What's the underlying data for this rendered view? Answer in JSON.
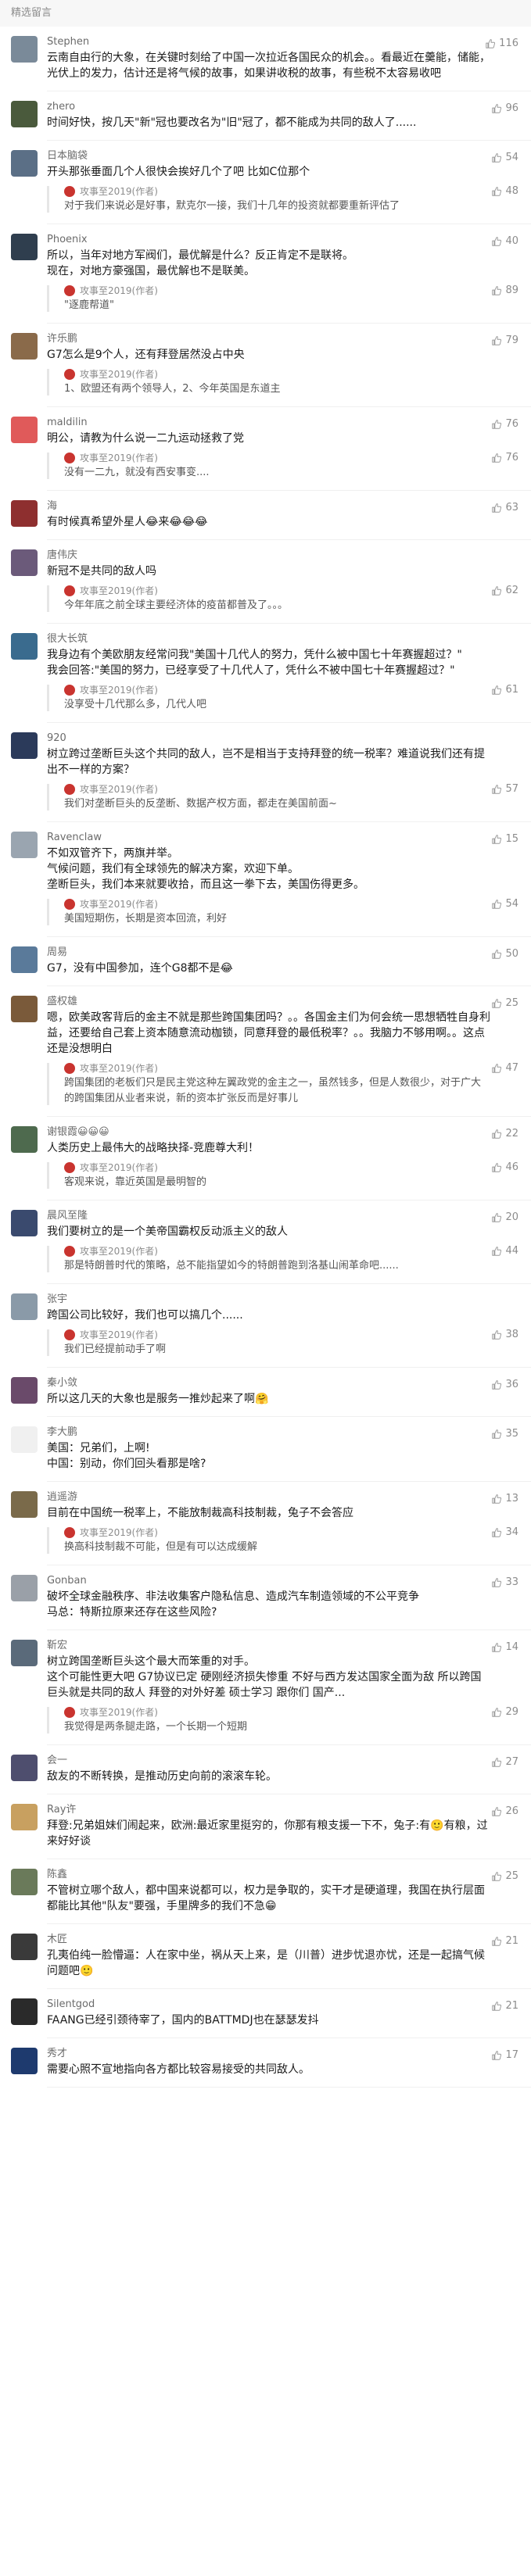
{
  "section_title": "精选留言",
  "author_name": "攻事至2019(作者)",
  "comments": [
    {
      "nick": "Stephen",
      "likes": "116",
      "avatar_color": "#7a8a99",
      "content": "云南自由行的大象，在关键时刻给了中国一次拉近各国民众的机会。。看最近在羹能，储能，光伏上的发力，估计还是将气候的故事，如果讲收税的故事，有些税不太容易收吧",
      "reply": null
    },
    {
      "nick": "zhero",
      "likes": "96",
      "avatar_color": "#4a5a3c",
      "content": "时间好快，按几天\"新\"冠也要改名为\"旧\"冠了，都不能成为共同的敌人了......",
      "reply": null
    },
    {
      "nick": "日本脑袋",
      "likes": "54",
      "avatar_color": "#5b6f86",
      "content": "开头那张垂面几个人很快会挨好几个了吧 比如C位那个",
      "reply": {
        "likes": "48",
        "content": "对于我们来说必是好事，默克尔一接，我们十几年的投资就都要重新评估了"
      }
    },
    {
      "nick": "Phoenix",
      "likes": "40",
      "avatar_color": "#2f3e4e",
      "content": "所以，当年对地方军阀们，最优解是什么？反正肯定不是联将。\n现在，对地方豪强国，最优解也不是联美。",
      "reply": {
        "likes": "89",
        "content": "\"逐鹿帮道\""
      }
    },
    {
      "nick": "许乐鹏",
      "likes": "79",
      "avatar_color": "#8a6a4a",
      "content": "G7怎么是9个人，还有拜登居然没占中央",
      "reply": {
        "likes": "",
        "content": "1、欧盟还有两个领导人，2、今年英国是东道主"
      }
    },
    {
      "nick": "maldilin",
      "likes": "76",
      "avatar_color": "#e05a5a",
      "content": "明公，请教为什么说一二九运动拯救了党",
      "reply": {
        "likes": "76",
        "content": "没有一二九，就没有西安事变...."
      }
    },
    {
      "nick": "海",
      "likes": "63",
      "avatar_color": "#8e2f2f",
      "content": "有时候真希望外星人😂来😂😂😂",
      "reply": null
    },
    {
      "nick": "唐伟庆",
      "likes": "",
      "avatar_color": "#6b5a7a",
      "content": "新冠不是共同的敌人吗",
      "reply": {
        "likes": "62",
        "content": "今年年底之前全球主要经济体的疫苗都普及了。。。"
      }
    },
    {
      "nick": "很大长筑",
      "likes": "",
      "avatar_color": "#3a6b8e",
      "content": "我身边有个美欧朋友经常问我\"美国十几代人的努力，凭什么被中国七十年赛握超过？\"\n我会回答:\"美国的努力，已经享受了十几代人了，凭什么不被中国七十年赛握超过？\"",
      "reply": {
        "likes": "61",
        "content": "没享受十几代那么多，几代人吧"
      }
    },
    {
      "nick": "920",
      "likes": "",
      "avatar_color": "#2b3a5a",
      "content": "树立跨过垄断巨头这个共同的敌人，岂不是相当于支持拜登的统一税率？难道说我们还有提出不一样的方案？",
      "reply": {
        "likes": "57",
        "content": "我们对垄断巨头的反垄断、数据产权方面，都走在美国前面~"
      }
    },
    {
      "nick": "Ravenclaw",
      "likes": "15",
      "avatar_color": "#9aa5b0",
      "content": "不如双管齐下，两旗并举。\n气候问题，我们有全球领先的解决方案，欢迎下单。\n垄断巨头，我们本来就要收拾，而且这一拳下去，美国伤得更多。",
      "reply": {
        "likes": "54",
        "content": "美国短期伤，长期是资本回流，利好"
      }
    },
    {
      "nick": "周易",
      "likes": "50",
      "avatar_color": "#5a7a9a",
      "content": "G7，没有中国参加，连个G8都不是😂",
      "reply": null
    },
    {
      "nick": "盛权雄",
      "likes": "25",
      "avatar_color": "#7a5a3a",
      "content": "嗯，欧美政客背后的金主不就是那些跨国集团吗？。。各国金主们为何会统一思想牺牲自身利益，还要给自己套上资本随意流动枷锁，同意拜登的最低税率？。。我脑力不够用啊。。这点还是没想明白",
      "reply": {
        "likes": "47",
        "content": "跨国集团的老板们只是民主党这种左翼政党的金主之一，虽然钱多，但是人数很少，对于广大的跨国集团从业者来说，新的资本扩张反而是好事儿"
      }
    },
    {
      "nick": "谢银霞😀😀😀",
      "likes": "22",
      "avatar_color": "#4e6a4e",
      "content": "人类历史上最伟大的战略抉择-竞鹿尊大利！",
      "reply": {
        "likes": "46",
        "content": "客观来说，靠近英国是最明智的"
      }
    },
    {
      "nick": "晨风至隆",
      "likes": "20",
      "avatar_color": "#3a4a6e",
      "content": "我们要树立的是一个美帝国霸权反动派主义的敌人",
      "reply": {
        "likes": "44",
        "content": "那是特朗普时代的策略，总不能指望如今的特朗普跑到洛基山闹革命吧......"
      }
    },
    {
      "nick": "张宇",
      "likes": "",
      "avatar_color": "#8a9aa8",
      "content": "跨国公司比较好，我们也可以搞几个......",
      "reply": {
        "likes": "38",
        "content": "我们已经提前动手了啊"
      }
    },
    {
      "nick": "秦小敛",
      "likes": "36",
      "avatar_color": "#6a4a6a",
      "content": "所以这几天的大象也是服务一推炒起来了啊🤗",
      "reply": null
    },
    {
      "nick": "李大鹏",
      "likes": "35",
      "avatar_color": "#f0f0f0",
      "content": "美国：兄弟们，上啊!\n中国：别动，你们回头看那是啥?",
      "reply": null
    },
    {
      "nick": "逍遥游",
      "likes": "13",
      "avatar_color": "#7a6a4a",
      "content": "目前在中国统一税率上，不能放制裁高科技制裁，兔子不会答应",
      "reply": {
        "likes": "34",
        "content": "换高科技制裁不可能，但是有可以达成缓解"
      }
    },
    {
      "nick": "Gonban",
      "likes": "33",
      "avatar_color": "#9aa0a8",
      "content": "破坏全球金融秩序、非法收集客户隐私信息、造成汽车制造领域的不公平竞争\n马总：特斯拉原来还存在这些风险?",
      "reply": null
    },
    {
      "nick": "靳宏",
      "likes": "14",
      "avatar_color": "#5a6a7a",
      "content": "树立跨国垄断巨头这个最大而笨重的对手。\n这个可能性更大吧 G7协议已定 硬刚经济损失惨重 不好与西方发达国家全面为敌 所以跨国巨头就是共同的敌人 拜登的对外好差 硕士学习 跟你们 国产...",
      "reply": {
        "likes": "29",
        "content": "我觉得是两条腿走路，一个长期一个短期"
      }
    },
    {
      "nick": "会一",
      "likes": "27",
      "avatar_color": "#4e4e6e",
      "content": "敌友的不断转换，是推动历史向前的滚滚车轮。",
      "reply": null
    },
    {
      "nick": "Ray许",
      "likes": "26",
      "avatar_color": "#c8a060",
      "content": "拜登:兄弟姐妹们闹起来，欧洲:最近家里挺穷的，你那有粮支援一下不，兔子:有🙂有粮，过来好好谈",
      "reply": null
    },
    {
      "nick": "陈鑫",
      "likes": "25",
      "avatar_color": "#6a7a5a",
      "content": "不管树立哪个敌人，都中国来说都可以，权力是争取的，实干才是硬道理，我国在执行层面都能比其他\"队友\"要强，手里牌多的我们不急😁",
      "reply": null
    },
    {
      "nick": "木匠",
      "likes": "21",
      "avatar_color": "#3a3a3a",
      "content": "孔夷伯纯一脸懵逼：人在家中坐，祸从天上来，是（川普）进步忧退亦忧，还是一起搞气候问题吧🙂",
      "reply": null
    },
    {
      "nick": "Silentgod",
      "likes": "21",
      "avatar_color": "#2a2a2a",
      "content": "FAANG已经引颈待宰了，国内的BATTMDJ也在瑟瑟发抖",
      "reply": null
    },
    {
      "nick": "秀才",
      "likes": "17",
      "avatar_color": "#1e3a6e",
      "content": "需要心照不宣地指向各方都比较容易接受的共同敌人。",
      "reply": null
    }
  ]
}
